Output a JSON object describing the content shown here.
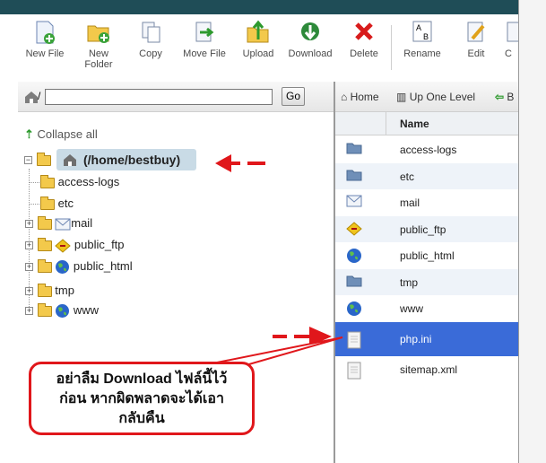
{
  "toolbar": {
    "buttons": [
      {
        "label": "New File",
        "icon": "new-file-icon"
      },
      {
        "label": "New\nFolder",
        "icon": "new-folder-icon"
      },
      {
        "label": "Copy",
        "icon": "copy-icon"
      },
      {
        "label": "Move File",
        "icon": "move-file-icon"
      },
      {
        "label": "Upload",
        "icon": "upload-icon"
      },
      {
        "label": "Download",
        "icon": "download-icon"
      },
      {
        "label": "Delete",
        "icon": "delete-icon"
      },
      {
        "label": "Rename",
        "icon": "rename-icon"
      },
      {
        "label": "Edit",
        "icon": "edit-icon"
      },
      {
        "label": "C",
        "icon": "code-edit-icon"
      }
    ]
  },
  "pathbar": {
    "path_prefix": "/",
    "path_value": "",
    "go_label": "Go"
  },
  "tree": {
    "collapse_label": "Collapse all",
    "root_label": "(/home/bestbuy)",
    "items": [
      {
        "label": "access-logs",
        "icon": "folder-icon",
        "expandable": false
      },
      {
        "label": "etc",
        "icon": "folder-icon",
        "expandable": false
      },
      {
        "label": "mail",
        "icon": "mail-icon",
        "expandable": true
      },
      {
        "label": "public_ftp",
        "icon": "ftp-icon",
        "expandable": true
      },
      {
        "label": "public_html",
        "icon": "globe-icon",
        "expandable": true
      },
      {
        "label": "tmp",
        "icon": "folder-icon",
        "expandable": true
      },
      {
        "label": "www",
        "icon": "globe-icon",
        "expandable": true
      }
    ]
  },
  "nav": {
    "home": "Home",
    "up": "Up One Level",
    "back": "B"
  },
  "file_list": {
    "column_name": "Name",
    "rows": [
      {
        "name": "access-logs",
        "icon": "folder-icon",
        "selected": false
      },
      {
        "name": "etc",
        "icon": "folder-icon",
        "selected": false
      },
      {
        "name": "mail",
        "icon": "mail-icon",
        "selected": false
      },
      {
        "name": "public_ftp",
        "icon": "ftp-icon",
        "selected": false
      },
      {
        "name": "public_html",
        "icon": "globe-icon",
        "selected": false
      },
      {
        "name": "tmp",
        "icon": "folder-icon",
        "selected": false
      },
      {
        "name": "www",
        "icon": "globe-icon",
        "selected": false
      },
      {
        "name": "php.ini",
        "icon": "file-icon",
        "selected": true
      },
      {
        "name": "sitemap.xml",
        "icon": "file-icon",
        "selected": false
      }
    ]
  },
  "callout": {
    "line1": "อย่าลืม Download ไฟล์นี้ไว้",
    "line2": "ก่อน หากผิดพลาดจะได้เอา",
    "line3": "กลับคืน"
  },
  "colors": {
    "selected_row": "#3a6bd8",
    "annotation_red": "#e0171b",
    "top_bar": "#1f4d57",
    "alt_row": "#eef3f9"
  }
}
